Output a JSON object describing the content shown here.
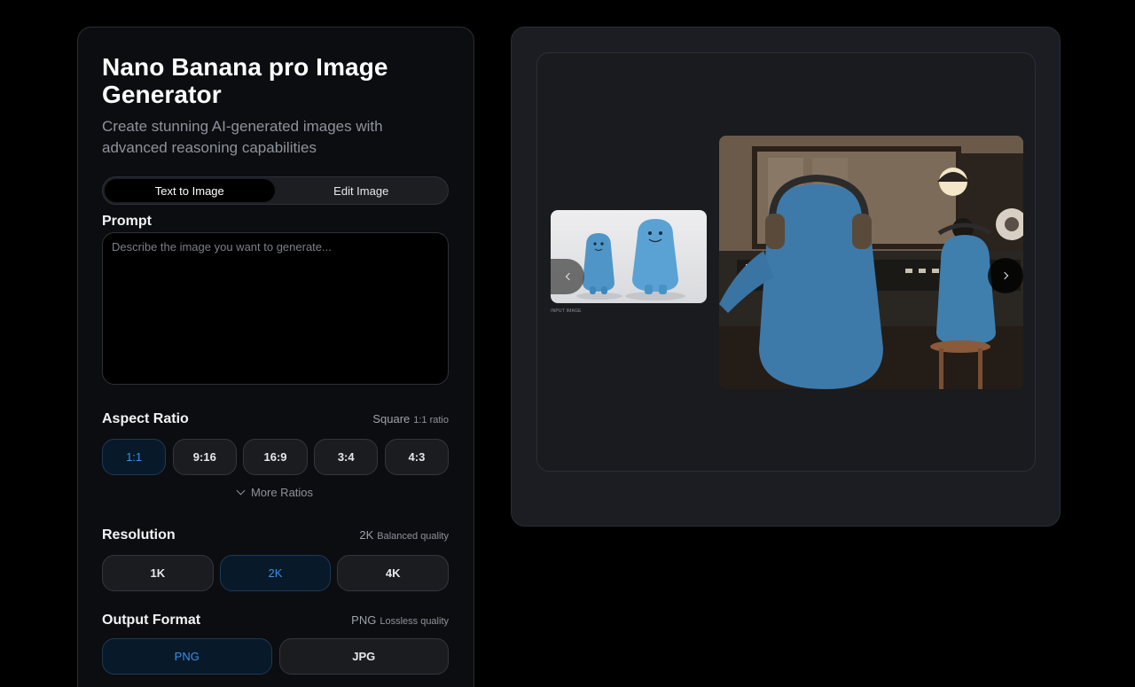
{
  "header": {
    "title": "Nano Banana pro Image Generator",
    "subtitle": "Create stunning AI-generated images with advanced reasoning capabilities"
  },
  "mode_tabs": [
    {
      "label": "Text to Image",
      "active": true
    },
    {
      "label": "Edit Image",
      "active": false
    }
  ],
  "prompt": {
    "label": "Prompt",
    "placeholder": "Describe the image you want to generate...",
    "value": ""
  },
  "aspect_ratio": {
    "label": "Aspect Ratio",
    "selected_name": "Square",
    "selected_desc": "1:1 ratio",
    "options": [
      "1:1",
      "9:16",
      "16:9",
      "3:4",
      "4:3"
    ],
    "selected": "1:1",
    "more_label": "More Ratios"
  },
  "resolution": {
    "label": "Resolution",
    "selected_name": "2K",
    "selected_desc": "Balanced quality",
    "options": [
      "1K",
      "2K",
      "4K"
    ],
    "selected": "2K"
  },
  "output_format": {
    "label": "Output Format",
    "selected_name": "PNG",
    "selected_desc": "Lossless quality",
    "options": [
      "PNG",
      "JPG"
    ],
    "selected": "PNG"
  },
  "preview": {
    "input_caption": "INPUT IMAGE"
  },
  "colors": {
    "accent": "#3b8fe6",
    "background": "#000000",
    "panel": "#0c0d10"
  }
}
